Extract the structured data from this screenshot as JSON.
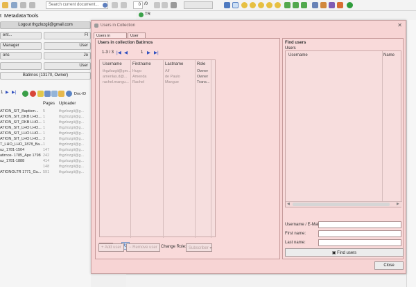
{
  "toolbar": {
    "search_placeholder": "Search current document...",
    "page_value": "0",
    "page_total": "/0"
  },
  "menubar": {
    "items": [
      "t",
      "Metadata",
      "Tools"
    ]
  },
  "tabs": {
    "tr_label": "TR"
  },
  "left_panel": {
    "logout_label": "Logout thgzlozgii@gmail.com",
    "btn_1": "ent...",
    "btn_2": "Manager",
    "btn_3": "ons",
    "btn_fl": "Fl",
    "btn_user": "User",
    "btn_jo": "Jo",
    "btn_user2": "User",
    "collection_label": "Batirnos (13170, Owner)",
    "page_input": "1",
    "doc_id_label": "Doc-ID",
    "col_pages": "Pages",
    "col_uploader": "Uploader",
    "rows": [
      {
        "title": "ATION_SIT_Baptism...",
        "pages": "5",
        "uploader": "thgzlozgii@g..."
      },
      {
        "title": "ATION_SIT_DKB LHO...",
        "pages": "1",
        "uploader": "thgzlozgii@g..."
      },
      {
        "title": "ATION_SIT_DKB LHO...",
        "pages": "1",
        "uploader": "thgzlozgii@g..."
      },
      {
        "title": "ATION_SIT_LHO LHO...",
        "pages": "1",
        "uploader": "thgzlozgii@g..."
      },
      {
        "title": "ATION_SIT_LHO LHO...",
        "pages": "1",
        "uploader": "thgzlozgii@g..."
      },
      {
        "title": "ATION_SIT_LHO LHO...",
        "pages": "3",
        "uploader": "thgzlozgii@g..."
      },
      {
        "title": "T_LHO_LHO_1878_Ba...",
        "pages": "1",
        "uploader": "thgzlozgii@g..."
      },
      {
        "title": "uz_1781-1504",
        "pages": "147",
        "uploader": "thgzlozgii@g..."
      },
      {
        "title": "atirnos- 1785_Apo 1798",
        "pages": "242",
        "uploader": "thgzlozgii@g..."
      },
      {
        "title": "uz_1781-1888",
        "pages": "414",
        "uploader": "thgzlozgii@g..."
      },
      {
        "title": "",
        "pages": "148",
        "uploader": "thgzlozgii@g..."
      },
      {
        "title": "ATIONOLTR 1771_Gu...",
        "pages": "591",
        "uploader": "thgzlozgii@g..."
      }
    ]
  },
  "dialog": {
    "title": "Users in Collection",
    "close_glyph": "✕",
    "tabs": [
      "Users in collection",
      "User Info"
    ],
    "users_panel_title": "Users in collection Batirnos",
    "pager_range": "1-3 / 3",
    "pager_page": "1",
    "table_headers": [
      "Username",
      "Firstname",
      "Lastname",
      "Role"
    ],
    "table_rows": [
      {
        "username": "thgzlozgii@gm...",
        "firstname": "Hugo",
        "lastname": "Alf",
        "role": "Owner"
      },
      {
        "username": "amenlas.d@...",
        "firstname": "Amenda",
        "lastname": "de Paulo",
        "role": "Owner"
      },
      {
        "username": "rachel.mangu...",
        "firstname": "Rachel",
        "lastname": "Mangue",
        "role": "Trans..."
      }
    ],
    "page_size": "25",
    "add_user": "Add user",
    "remove_user": "Remove user",
    "change_role_label": "Change Role:",
    "role_value": "Subscriber",
    "find_users_title": "Find users",
    "users_label": "Users",
    "find_headers": [
      "Username",
      "Name"
    ],
    "username_label": "Username / E-Mail:",
    "firstname_label": "First name:",
    "lastname_label": "Last name:",
    "find_button": "Find users",
    "close_button": "Close"
  }
}
